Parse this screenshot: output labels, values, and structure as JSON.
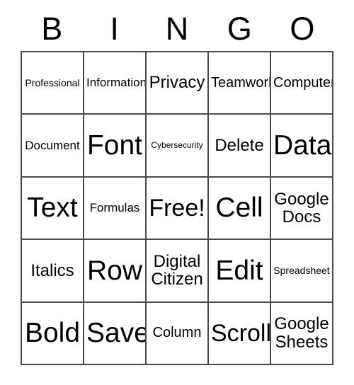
{
  "card": {
    "header_letters": [
      "B",
      "I",
      "N",
      "G",
      "O"
    ],
    "rows": [
      [
        {
          "text": "Professional",
          "size": "fs-xs"
        },
        {
          "text": "Information",
          "size": "fs-s"
        },
        {
          "text": "Privacy",
          "size": "fs-ml"
        },
        {
          "text": "Teamwork",
          "size": "fs-m"
        },
        {
          "text": "Computer",
          "size": "fs-m"
        }
      ],
      [
        {
          "text": "Document",
          "size": "fs-s"
        },
        {
          "text": "Font",
          "size": "fs-xxl"
        },
        {
          "text": "Cybersecurity",
          "size": "fs-xxs"
        },
        {
          "text": "Delete",
          "size": "fs-ml"
        },
        {
          "text": "Data",
          "size": "fs-xxl"
        }
      ],
      [
        {
          "text": "Text",
          "size": "fs-xxl"
        },
        {
          "text": "Formulas",
          "size": "fs-s"
        },
        {
          "text": "Free!",
          "size": "fs-xl"
        },
        {
          "text": "Cell",
          "size": "fs-xxl"
        },
        {
          "text": "Google\nDocs",
          "size": "fs-ml"
        }
      ],
      [
        {
          "text": "Italics",
          "size": "fs-ml"
        },
        {
          "text": "Row",
          "size": "fs-xxl"
        },
        {
          "text": "Digital\nCitizen",
          "size": "fs-ml"
        },
        {
          "text": "Edit",
          "size": "fs-xxl"
        },
        {
          "text": "Spreadsheet",
          "size": "fs-xs"
        }
      ],
      [
        {
          "text": "Bold",
          "size": "fs-xxl"
        },
        {
          "text": "Save",
          "size": "fs-xxl"
        },
        {
          "text": "Column",
          "size": "fs-m"
        },
        {
          "text": "Scroll",
          "size": "fs-xl"
        },
        {
          "text": "Google\nSheets",
          "size": "fs-ml"
        }
      ]
    ]
  }
}
